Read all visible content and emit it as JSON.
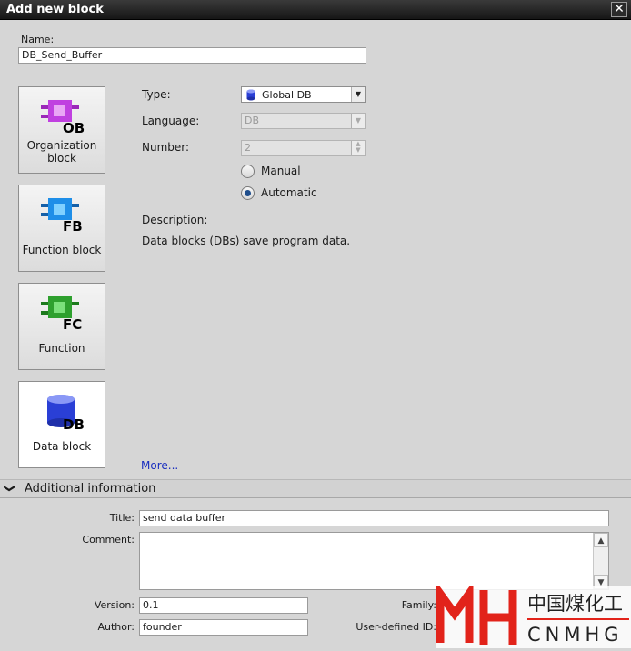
{
  "dialog": {
    "title": "Add new block",
    "close_glyph": "✕"
  },
  "name": {
    "label": "Name:",
    "value": "DB_Send_Buffer"
  },
  "blocks": [
    {
      "icon_tag": "OB",
      "label_line1": "Organization",
      "label_line2": "block",
      "color": "#c040e0"
    },
    {
      "icon_tag": "FB",
      "label_line1": "Function block",
      "label_line2": "",
      "color": "#1e8ee8"
    },
    {
      "icon_tag": "FC",
      "label_line1": "Function",
      "label_line2": "",
      "color": "#2ea02e"
    },
    {
      "icon_tag": "DB",
      "label_line1": "Data block",
      "label_line2": "",
      "color": "#2a3fd6",
      "selected": true
    }
  ],
  "form": {
    "type_label": "Type:",
    "type_value": "Global DB",
    "language_label": "Language:",
    "language_value": "DB",
    "number_label": "Number:",
    "number_value": "2",
    "manual_label": "Manual",
    "automatic_label": "Automatic",
    "numbering_mode": "Automatic",
    "description_label": "Description:",
    "description_text": "Data blocks (DBs) save program data.",
    "more_link": "More..."
  },
  "additional": {
    "header": "Additional  information",
    "title_label": "Title:",
    "title_value": "send data buffer",
    "comment_label": "Comment:",
    "comment_value": "",
    "version_label": "Version:",
    "version_value": "0.1",
    "family_label": "Family:",
    "family_value": "",
    "author_label": "Author:",
    "author_value": "founder",
    "user_id_label": "User-defined ID:",
    "user_id_value": ""
  },
  "watermark": {
    "cn_text": "中国煤化工",
    "en_text": "CNMHG"
  },
  "colors": {
    "titlebar": "#1e1e1e",
    "link": "#1a2fbf",
    "accent_red": "#e2231a"
  }
}
